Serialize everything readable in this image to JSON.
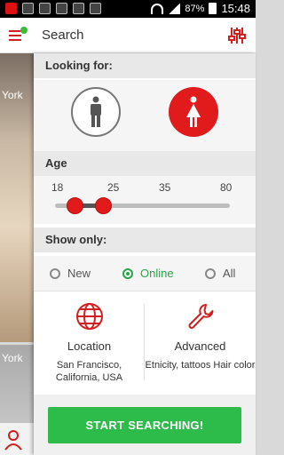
{
  "status_bar": {
    "battery": "87%",
    "time": "15:48"
  },
  "app_bar": {
    "title": "Search",
    "menu_icon": "hamburger-menu-icon",
    "filter_icon": "filter-sliders-icon"
  },
  "background_list": {
    "cities": [
      "York",
      "York"
    ]
  },
  "looking_for": {
    "heading": "Looking for:",
    "options": [
      {
        "name": "male",
        "icon": "male-icon",
        "selected": false
      },
      {
        "name": "female",
        "icon": "female-icon",
        "selected": true
      }
    ]
  },
  "age": {
    "heading": "Age",
    "labels": [
      "18",
      "25",
      "35",
      "80"
    ],
    "min": 18,
    "max": 80,
    "low": 25,
    "high": 35
  },
  "show_only": {
    "heading": "Show only:",
    "options": [
      {
        "label": "New",
        "selected": false
      },
      {
        "label": "Online",
        "selected": true
      },
      {
        "label": "All",
        "selected": false
      }
    ]
  },
  "location": {
    "title": "Location",
    "value": "San Francisco, California, USA",
    "icon": "globe-icon"
  },
  "advanced": {
    "title": "Advanced",
    "value": "Etnicity, tattoos Hair color",
    "icon": "wrench-icon"
  },
  "start_button": "START SEARCHING!",
  "colors": {
    "accent_red": "#e11b1b",
    "accent_green": "#2dbb4a",
    "panel_gray": "#e8e8e8"
  }
}
